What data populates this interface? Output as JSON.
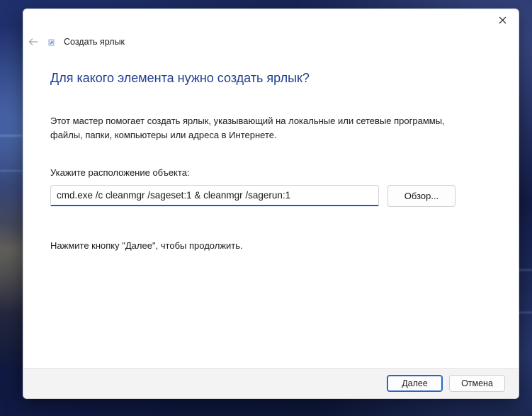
{
  "dialog": {
    "header_title": "Создать ярлык",
    "heading": "Для какого элемента нужно создать ярлык?",
    "description": "Этот мастер помогает создать ярлык, указывающий на локальные или сетевые программы, файлы, папки, компьютеры или адреса в Интернете.",
    "location_label": "Укажите расположение объекта:",
    "location_value": "cmd.exe /c cleanmgr /sageset:1 & cleanmgr /sagerun:1",
    "browse_label": "Обзор...",
    "hint": "Нажмите кнопку \"Далее\", чтобы продолжить.",
    "next_label": "Далее",
    "cancel_label": "Отмена"
  },
  "icons": {
    "close": "close-icon",
    "back": "back-arrow-icon",
    "wizard": "shortcut-wizard-icon"
  },
  "colors": {
    "heading": "#1f3f8f",
    "accent": "#1e5bbf",
    "footer_bg": "#f3f3f3"
  }
}
